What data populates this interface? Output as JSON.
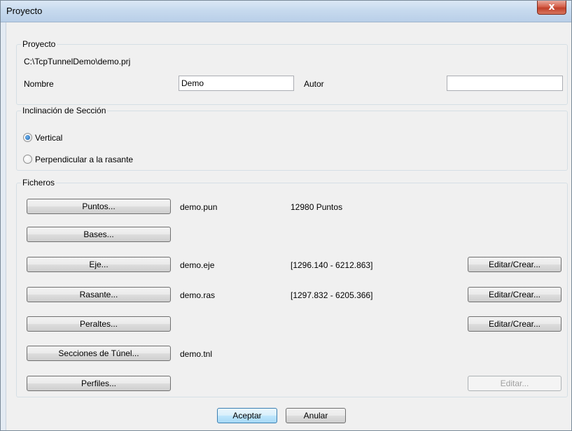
{
  "window": {
    "title": "Proyecto",
    "close_glyph": "x"
  },
  "proyecto": {
    "group_label": "Proyecto",
    "path": "C:\\TcpTunnelDemo\\demo.prj",
    "nombre_label": "Nombre",
    "nombre_value": "Demo",
    "autor_label": "Autor",
    "autor_value": ""
  },
  "inclinacion": {
    "group_label": "Inclinación de Sección",
    "options": [
      {
        "label": "Vertical",
        "checked": true
      },
      {
        "label": "Perpendicular a la rasante",
        "checked": false
      }
    ]
  },
  "ficheros": {
    "group_label": "Ficheros",
    "rows": [
      {
        "button": "Puntos...",
        "file": "demo.pun",
        "info": "12980 Puntos",
        "action": ""
      },
      {
        "button": "Bases...",
        "file": "",
        "info": "",
        "action": ""
      },
      {
        "button": "Eje...",
        "file": "demo.eje",
        "info": "[1296.140 - 6212.863]",
        "action": "Editar/Crear..."
      },
      {
        "button": "Rasante...",
        "file": "demo.ras",
        "info": "[1297.832 - 6205.366]",
        "action": "Editar/Crear..."
      },
      {
        "button": "Peraltes...",
        "file": "",
        "info": "",
        "action": "Editar/Crear..."
      },
      {
        "button": "Secciones de Túnel...",
        "file": "demo.tnl",
        "info": "",
        "action": ""
      },
      {
        "button": "Perfiles...",
        "file": "",
        "info": "",
        "action": "Editar..."
      }
    ]
  },
  "footer": {
    "ok_label": "Aceptar",
    "cancel_label": "Anular"
  },
  "colors": {
    "accent": "#3c7fb1",
    "close": "#c0402a"
  }
}
